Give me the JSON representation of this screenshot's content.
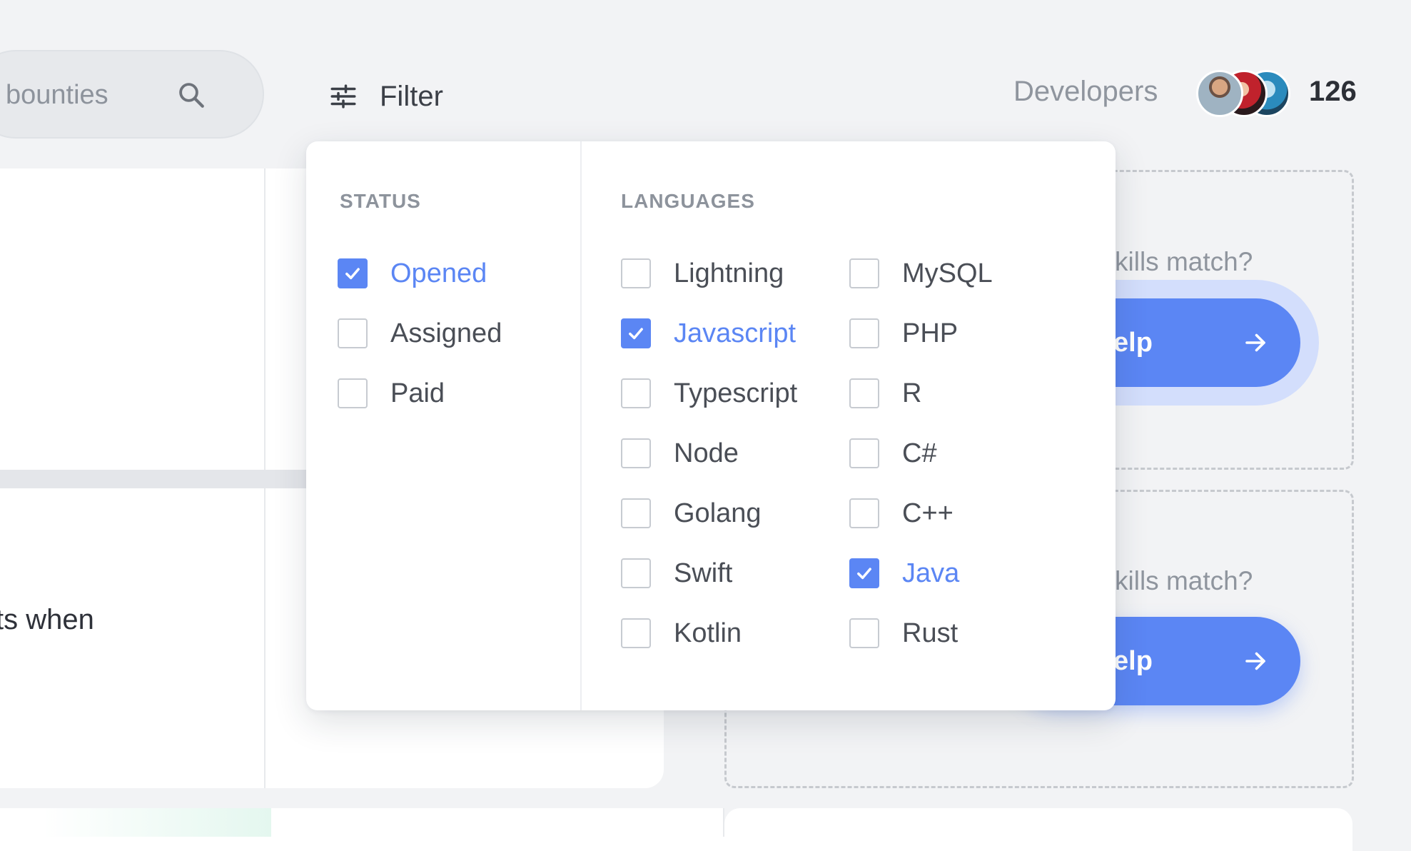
{
  "search": {
    "placeholder": "bounties",
    "icon": "search-icon"
  },
  "filter": {
    "label": "Filter",
    "icon": "sliders-icon"
  },
  "developers": {
    "label": "Developers",
    "count": "126"
  },
  "dropdown": {
    "status": {
      "title": "STATUS",
      "options": [
        {
          "label": "Opened",
          "checked": true
        },
        {
          "label": "Assigned",
          "checked": false
        },
        {
          "label": "Paid",
          "checked": false
        }
      ]
    },
    "languages": {
      "title": "LANGUAGES",
      "col1": [
        {
          "label": "Lightning",
          "checked": false
        },
        {
          "label": "Javascript",
          "checked": true
        },
        {
          "label": "Typescript",
          "checked": false
        },
        {
          "label": "Node",
          "checked": false
        },
        {
          "label": "Golang",
          "checked": false
        },
        {
          "label": "Swift",
          "checked": false
        },
        {
          "label": "Kotlin",
          "checked": false
        }
      ],
      "col2": [
        {
          "label": "MySQL",
          "checked": false
        },
        {
          "label": "PHP",
          "checked": false
        },
        {
          "label": "R",
          "checked": false
        },
        {
          "label": "C#",
          "checked": false
        },
        {
          "label": "C++",
          "checked": false
        },
        {
          "label": "Java",
          "checked": true
        },
        {
          "label": "Rust",
          "checked": false
        }
      ]
    }
  },
  "cards": {
    "left_text": "ts when",
    "skills_question_1": "kills match?",
    "skills_question_2": "kills match?",
    "help_label_1": "elp",
    "help_label_2": "elp"
  },
  "colors": {
    "accent": "#5b86f4",
    "background": "#f2f3f5",
    "muted": "#8d939c"
  }
}
